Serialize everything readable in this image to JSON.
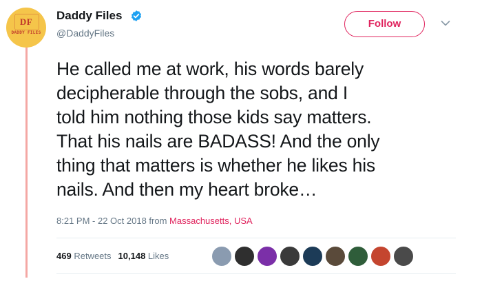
{
  "author": {
    "name": "Daddy Files",
    "handle": "@DaddyFiles",
    "avatar_text": "DF",
    "avatar_subtext": "DADDY FILES",
    "verified": true
  },
  "follow_label": "Follow",
  "tweet": {
    "line1": "He called me at work, his words barely",
    "line2": "decipherable through the sobs, and I",
    "line3": "told him nothing those kids say matters.",
    "line4": "That his nails are BADASS! And the only",
    "line5": "thing that matters is whether he likes his",
    "line6": "nails. And then my heart broke…"
  },
  "meta": {
    "time": "8:21 PM - 22 Oct 2018 from ",
    "location": "Massachusetts, USA"
  },
  "stats": {
    "retweets_count": "469",
    "retweets_label": "Retweets",
    "likes_count": "10,148",
    "likes_label": "Likes"
  },
  "liker_avatars": [
    {
      "color": "#8a9bb0"
    },
    {
      "color": "#2f2f2f"
    },
    {
      "color": "#7b2fa8"
    },
    {
      "color": "#3a3a3a"
    },
    {
      "color": "#1c3b57"
    },
    {
      "color": "#5a4a3a"
    },
    {
      "color": "#2f5d3a"
    },
    {
      "color": "#c4452f"
    },
    {
      "color": "#4a4a4a"
    }
  ],
  "colors": {
    "accent": "#e0245e",
    "verified": "#1da1f2",
    "thread_line": "#f4a7a4",
    "muted": "#657786"
  }
}
